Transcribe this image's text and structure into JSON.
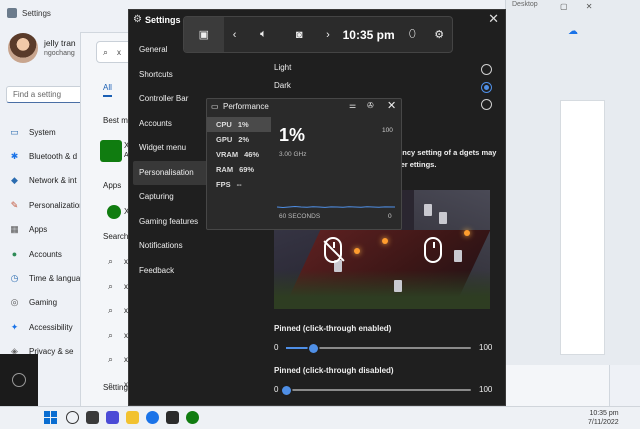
{
  "background_settings": {
    "title": "Settings",
    "user_name": "jelly tran",
    "user_email": "ngochang",
    "search_placeholder": "Find a setting",
    "nav": [
      {
        "icon": "▭",
        "label": "System"
      },
      {
        "icon": "✱",
        "label": "Bluetooth & d"
      },
      {
        "icon": "◆",
        "label": "Network & int"
      },
      {
        "icon": "✎",
        "label": "Personalization"
      },
      {
        "icon": "▦",
        "label": "Apps"
      },
      {
        "icon": "●",
        "label": "Accounts"
      },
      {
        "icon": "◷",
        "label": "Time & langua"
      },
      {
        "icon": "◎",
        "label": "Gaming"
      },
      {
        "icon": "✦",
        "label": "Accessibility"
      },
      {
        "icon": "◈",
        "label": "Privacy & se"
      }
    ]
  },
  "background_search": {
    "query": "x",
    "tab_all": "All",
    "best_match": "Best m",
    "apps_heading": "Apps",
    "searches_heading": "Search",
    "settings_heading": "Setting",
    "result_best": "X",
    "result_best_sub": "A",
    "result_app": "X",
    "search_rows": [
      "x",
      "x",
      "x",
      "x",
      "x",
      "x"
    ]
  },
  "desktop": {
    "window_label": "Desktop"
  },
  "game_bar_settings": {
    "title": "Settings",
    "nav": [
      "General",
      "Shortcuts",
      "Controller Bar",
      "Accounts",
      "Widget menu",
      "Personalisation",
      "Capturing",
      "Gaming features",
      "Notifications",
      "Feedback"
    ],
    "active_nav_index": 5,
    "theme_options": [
      "Light",
      "Dark",
      ""
    ],
    "selected_theme_index": 1,
    "transparency_text": "arency setting of a dgets may offer ettings.",
    "slider_enabled": {
      "label": "Pinned (click-through enabled)",
      "min": "0",
      "max": "100",
      "value": 15
    },
    "slider_disabled": {
      "label": "Pinned (click-through disabled)",
      "min": "0",
      "max": "100",
      "value": 0
    }
  },
  "game_bar": {
    "time": "10:35 pm"
  },
  "performance": {
    "title": "Performance",
    "metrics": [
      {
        "name": "CPU",
        "value": "1%"
      },
      {
        "name": "GPU",
        "value": "2%"
      },
      {
        "name": "VRAM",
        "value": "46%"
      },
      {
        "name": "RAM",
        "value": "69%"
      },
      {
        "name": "FPS",
        "value": "--"
      }
    ],
    "active_metric_index": 0,
    "big_value": "1%",
    "sub_value": "3.00 GHz",
    "y_max": "100",
    "y_min": "0",
    "x_label": "60 SECONDS"
  },
  "taskbar": {
    "time": "10:35 pm",
    "date": "7/11/2022"
  },
  "colors": {
    "accent": "#4f8fe6",
    "overlay_bg": "#1f1f1f",
    "widget_bg": "#2a2a2a"
  }
}
